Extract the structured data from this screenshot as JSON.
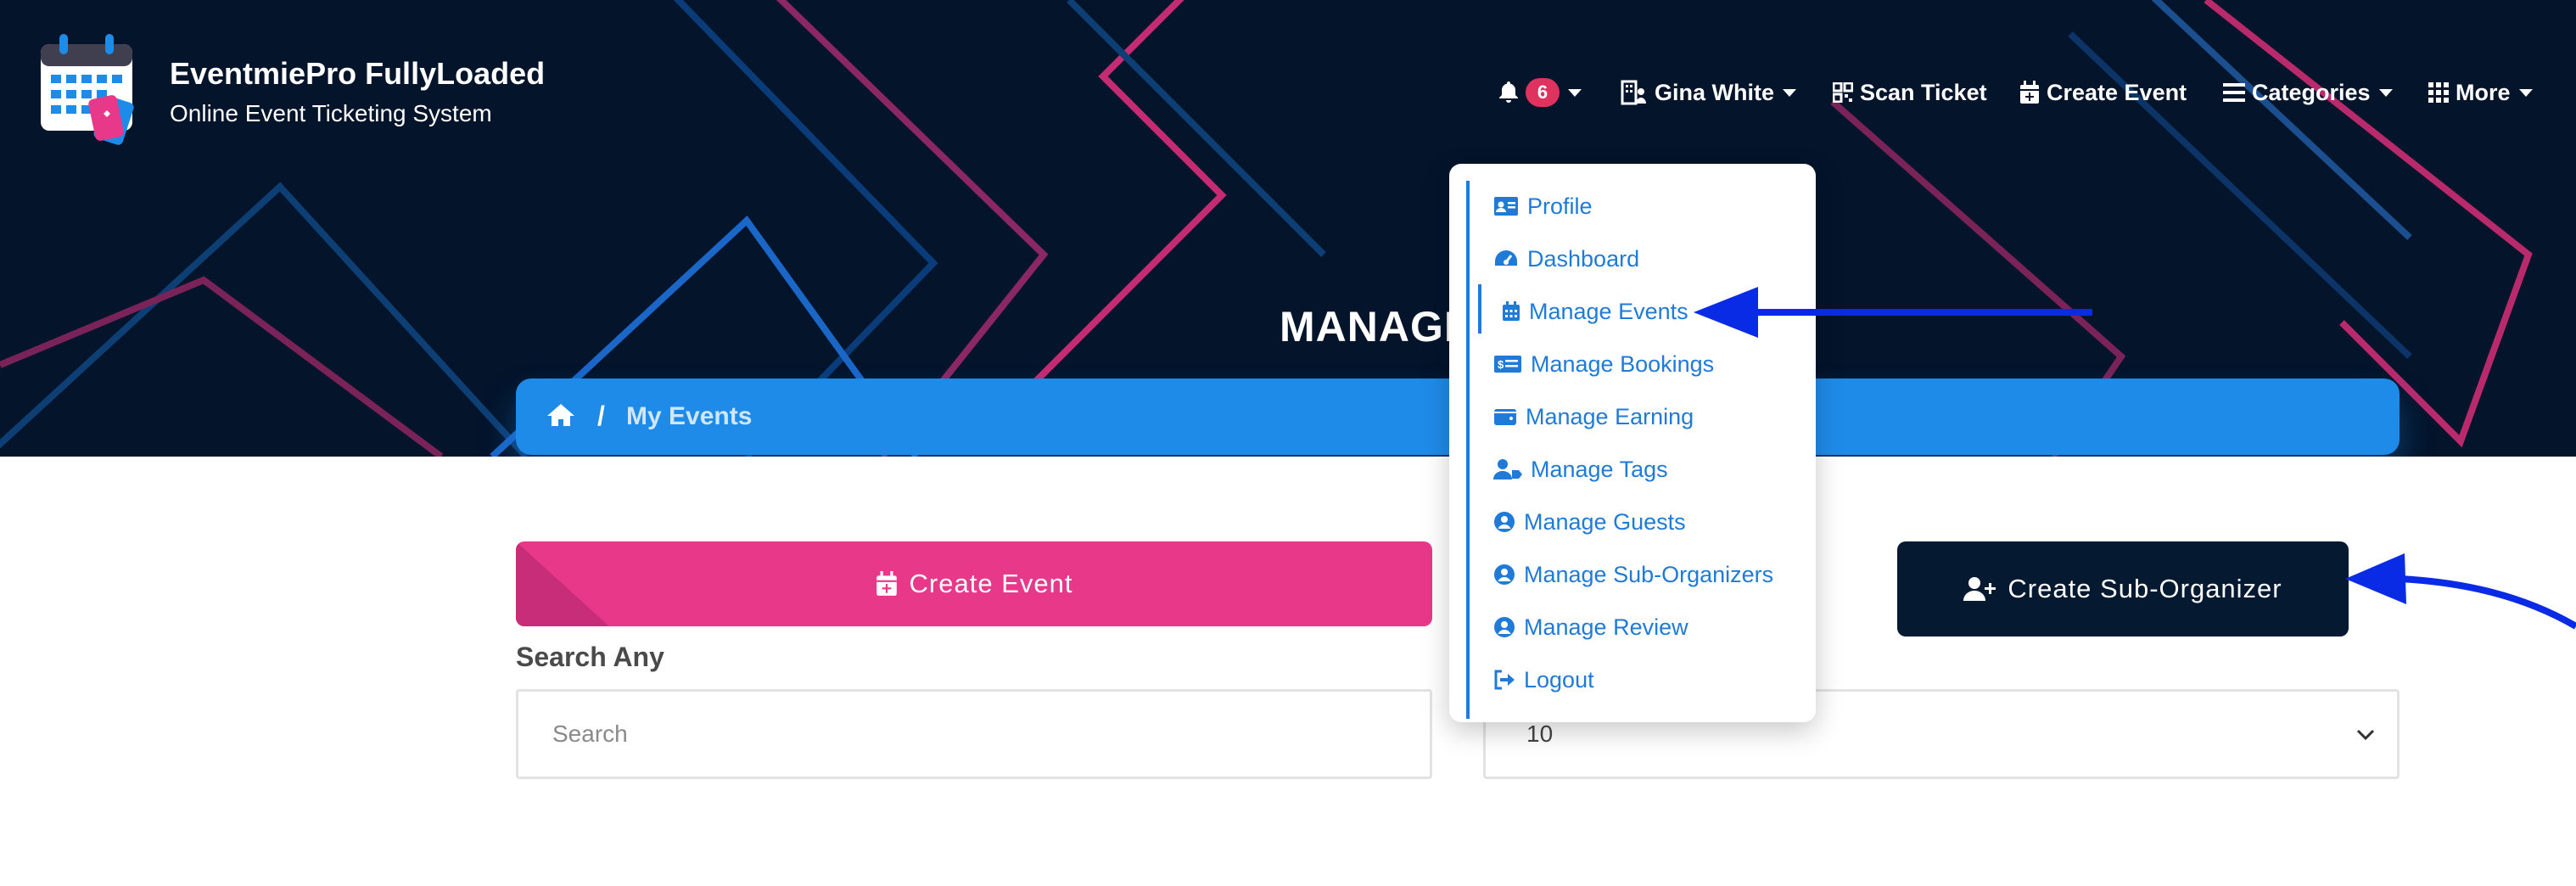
{
  "brand": {
    "title": "EventmiePro FullyLoaded",
    "subtitle": "Online Event Ticketing System"
  },
  "nav": {
    "notification_count": "6",
    "user_name": "Gina White",
    "scan_ticket": "Scan Ticket",
    "create_event": "Create Event",
    "categories": "Categories",
    "more": "More"
  },
  "page": {
    "heading": "MANAGE EVENTS"
  },
  "breadcrumb": {
    "current": "My Events"
  },
  "actions": {
    "create_event": "Create Event",
    "create_sub_organizer": "Create Sub-Organizer"
  },
  "search": {
    "label": "Search Any",
    "placeholder": "Search"
  },
  "per_page": {
    "selected": "10"
  },
  "user_menu": {
    "items": [
      {
        "label": "Profile",
        "icon": "id-card-icon"
      },
      {
        "label": "Dashboard",
        "icon": "gauge-icon"
      },
      {
        "label": "Manage Events",
        "icon": "calendar-icon"
      },
      {
        "label": "Manage Bookings",
        "icon": "money-bill-icon"
      },
      {
        "label": "Manage Earning",
        "icon": "wallet-icon"
      },
      {
        "label": "Manage Tags",
        "icon": "user-tag-icon"
      },
      {
        "label": "Manage Guests",
        "icon": "user-circle-icon"
      },
      {
        "label": "Manage Sub-Organizers",
        "icon": "user-circle-icon"
      },
      {
        "label": "Manage Review",
        "icon": "user-circle-icon"
      },
      {
        "label": "Logout",
        "icon": "sign-out-icon"
      }
    ]
  },
  "colors": {
    "hero_bg": "#03142b",
    "accent_blue": "#1f7ad8",
    "pink": "#e8388a",
    "navy": "#051a31",
    "badge_red": "#e0325f",
    "annotation_arrow": "#0a2be6"
  }
}
